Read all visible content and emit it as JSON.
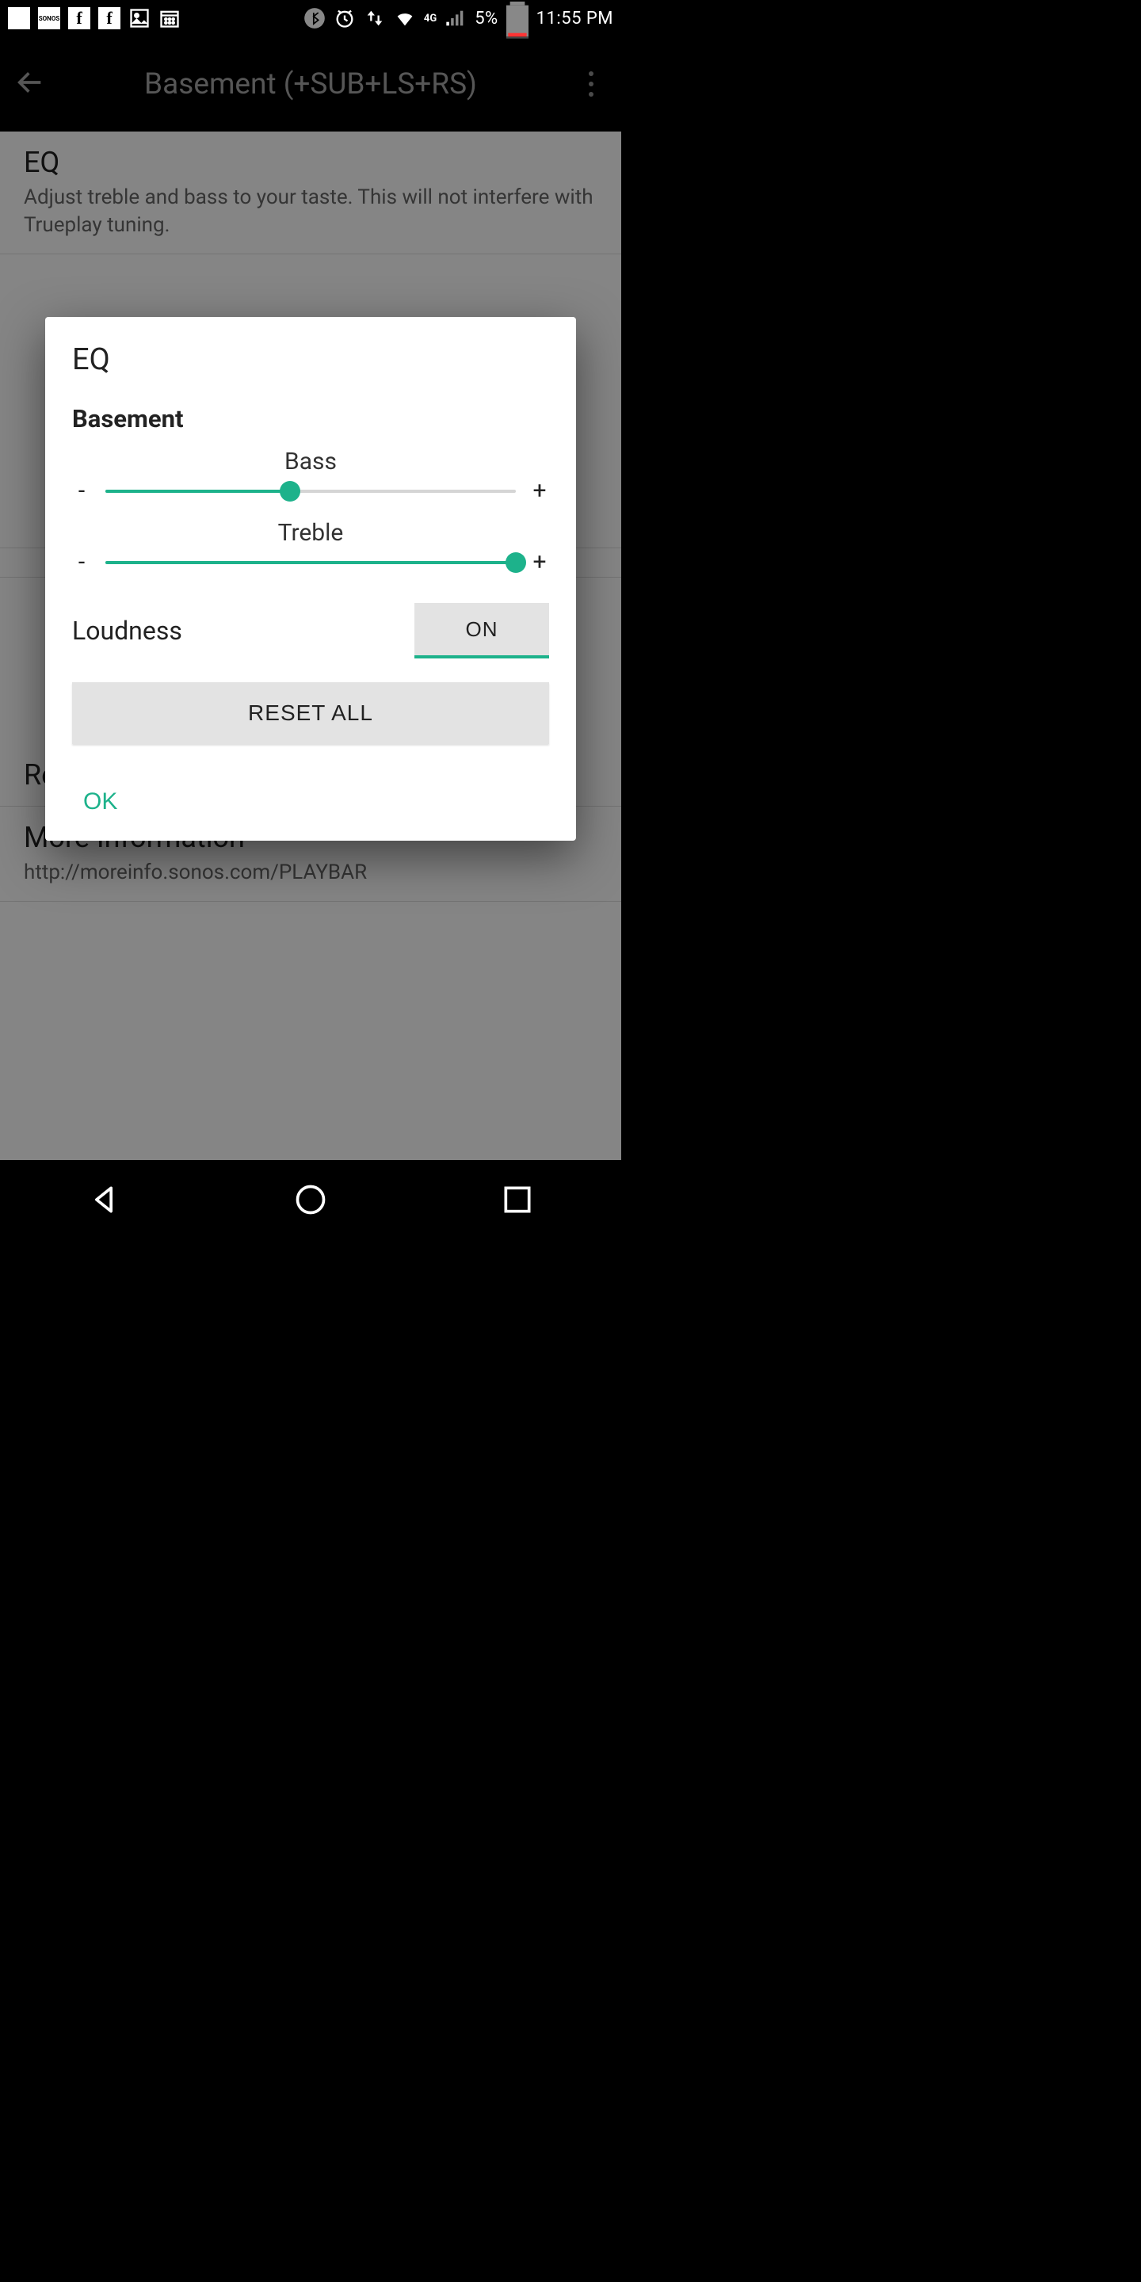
{
  "status": {
    "battery_pct": "5%",
    "time": "11:55 PM",
    "network": "4G",
    "icons": [
      "notification-dots",
      "sonos",
      "facebook",
      "facebook",
      "picture",
      "calendar",
      "bluetooth",
      "alarm",
      "data-sync",
      "wifi",
      "signal",
      "battery"
    ]
  },
  "appbar": {
    "title": "Basement (+SUB+LS+RS)"
  },
  "bg": {
    "eq_head": "EQ",
    "eq_sub": "Adjust treble and bass to your taste. This will not interfere with Trueplay tuning.",
    "remove_surrounds": "Remove Surrounds",
    "more_info_head": "More Information",
    "more_info_url": "http://moreinfo.sonos.com/PLAYBAR"
  },
  "modal": {
    "title": "EQ",
    "room": "Basement",
    "sliders": {
      "bass": {
        "label": "Bass",
        "minus": "-",
        "plus": "+",
        "value_pct": 45
      },
      "treble": {
        "label": "Treble",
        "minus": "-",
        "plus": "+",
        "value_pct": 100
      }
    },
    "loudness_label": "Loudness",
    "loudness_state": "ON",
    "reset": "RESET ALL",
    "ok": "OK"
  }
}
